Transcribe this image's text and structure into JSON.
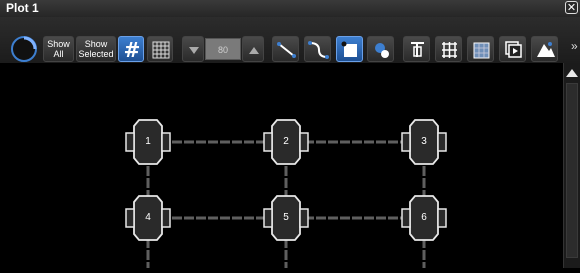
{
  "window": {
    "title": "Plot 1",
    "close_icon": "close-icon"
  },
  "toolbar": {
    "show_all": "Show All",
    "show_selected": "Show Selected",
    "stepper_value": "80",
    "more": "»"
  },
  "fixtures": [
    {
      "label": "1"
    },
    {
      "label": "2"
    },
    {
      "label": "3"
    },
    {
      "label": "4"
    },
    {
      "label": "5"
    },
    {
      "label": "6"
    }
  ],
  "colors": {
    "accent": "#2f6fc0",
    "fixture": "#2a2a2a",
    "outline": "#e8e8e8",
    "truss": "#6a6a6a"
  }
}
